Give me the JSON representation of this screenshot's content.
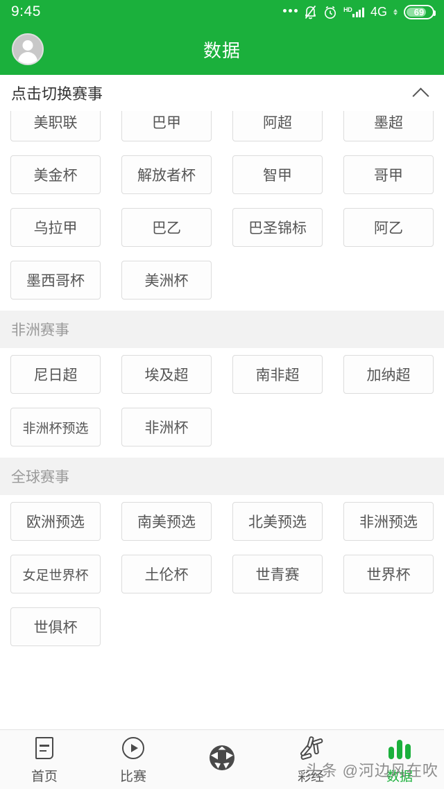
{
  "theme": {
    "brand_green": "#1BB03C",
    "chip_border": "#dcdcdc",
    "section_bg": "#f2f2f2",
    "active_tab_color": "#1BB03C"
  },
  "status_bar": {
    "time": "9:45",
    "network_type": "4G",
    "hd_label": "HD",
    "battery_level": "69",
    "icons": [
      "more-dots-icon",
      "bell-muted-icon",
      "alarm-clock-icon",
      "signal-bars-icon",
      "data-arrows-icon",
      "battery-icon"
    ]
  },
  "title_bar": {
    "title": "数据",
    "avatar": "user-avatar-icon"
  },
  "switch_header": {
    "label": "点击切换赛事",
    "chevron": "chevron-up-icon"
  },
  "sections": [
    {
      "header": null,
      "chips": [
        "美职联",
        "巴甲",
        "阿超",
        "墨超",
        "美金杯",
        "解放者杯",
        "智甲",
        "哥甲",
        "乌拉甲",
        "巴乙",
        "巴圣锦标",
        "阿乙",
        "墨西哥杯",
        "美洲杯"
      ]
    },
    {
      "header": "非洲赛事",
      "chips": [
        "尼日超",
        "埃及超",
        "南非超",
        "加纳超",
        "非洲杯预选",
        "非洲杯"
      ]
    },
    {
      "header": "全球赛事",
      "chips": [
        "欧洲预选",
        "南美预选",
        "北美预选",
        "非洲预选",
        "女足世界杯",
        "土伦杯",
        "世青赛",
        "世界杯",
        "世俱杯"
      ]
    }
  ],
  "tabbar": {
    "items": [
      {
        "label": "首页",
        "icon": "document-icon",
        "active": false
      },
      {
        "label": "比赛",
        "icon": "play-circle-icon",
        "active": false
      },
      {
        "label": "",
        "icon": "soccer-ball-icon",
        "active": false
      },
      {
        "label": "彩经",
        "icon": "lottery-sticks-icon",
        "active": false
      },
      {
        "label": "数据",
        "icon": "bar-chart-icon",
        "active": true
      }
    ]
  },
  "watermark": {
    "text": "头条 @河边风在吹"
  }
}
